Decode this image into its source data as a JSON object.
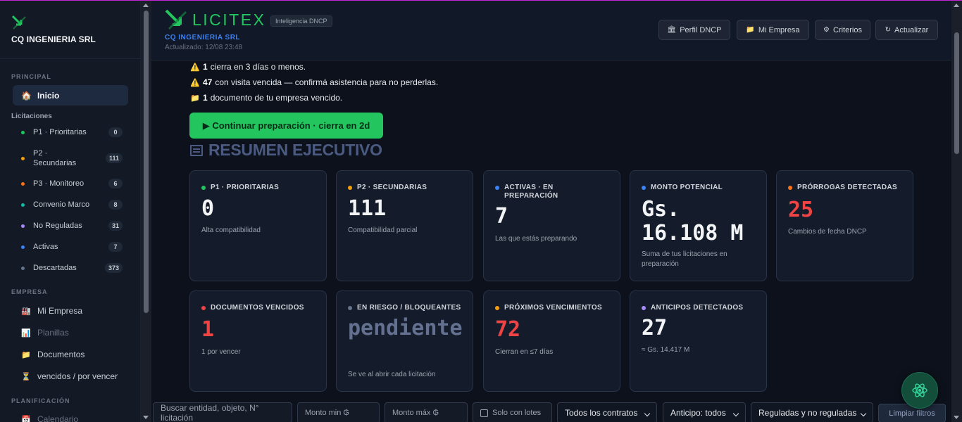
{
  "sidebar": {
    "company": "CQ INGENIERIA SRL",
    "section_principal": "PRINCIPAL",
    "home": {
      "icon": "house-icon",
      "label": "Inicio"
    },
    "section_licitaciones": "Licitaciones",
    "items": [
      {
        "label": "P1 · Prioritarias",
        "count": "0",
        "color": "#22c55e"
      },
      {
        "label": "P2 · Secundarias",
        "count": "111",
        "color": "#f59e0b"
      },
      {
        "label": "P3 · Monitoreo",
        "count": "6",
        "color": "#f97316"
      },
      {
        "label": "Convenio Marco",
        "count": "8",
        "color": "#14b8a6"
      },
      {
        "label": "No Reguladas",
        "count": "31",
        "color": "#a78bfa"
      },
      {
        "label": "Activas",
        "count": "7",
        "color": "#3b82f6"
      },
      {
        "label": "Descartadas",
        "count": "373",
        "color": "#64748b"
      }
    ],
    "section_empresa": "EMPRESA",
    "empresa_links": [
      {
        "label": "Mi Empresa",
        "icon": "factory-icon",
        "muted": false
      },
      {
        "label": "Planillas",
        "icon": "chart-icon",
        "muted": true
      },
      {
        "label": "Documentos",
        "icon": "folder-icon",
        "muted": false
      },
      {
        "label": "vencidos / por vencer",
        "icon": "hourglass-icon",
        "muted": false
      }
    ],
    "section_planificacion": "PLANIFICACIÓN",
    "planificacion_links": [
      {
        "label": "Calendario",
        "icon": "calendar-icon",
        "muted": true
      }
    ]
  },
  "header": {
    "brand": "LICITEX",
    "tag": "Inteligencia DNCP",
    "company": "CQ INGENIERIA SRL",
    "updated": "Actualizado: 12/08 23:48",
    "buttons": [
      {
        "label": "Perfil DNCP",
        "icon": "bank-icon"
      },
      {
        "label": "Mi Empresa",
        "icon": "folder-icon"
      },
      {
        "label": "Criterios",
        "icon": "gear-icon"
      },
      {
        "label": "Actualizar",
        "icon": "refresh-icon"
      }
    ]
  },
  "alerts": [
    {
      "icon": "warning-icon",
      "count": "1",
      "text": "cierra en 3 días o menos."
    },
    {
      "icon": "warning-icon",
      "count": "47",
      "text": "con visita vencida — confirmá asistencia para no perderlas."
    },
    {
      "icon": "folder-icon",
      "count": "1",
      "text": "documento de tu empresa vencido."
    }
  ],
  "cta": {
    "label": "▶ Continuar preparación · cierra en 2d"
  },
  "resumen": {
    "title": "RESUMEN EJECUTIVO"
  },
  "cards": [
    {
      "title": "P1 · PRIORITARIAS",
      "value": "0",
      "sub": "Alta compatibilidad",
      "dot": "#22c55e",
      "value_color": "#f3f4f6"
    },
    {
      "title": "P2 · SECUNDARIAS",
      "value": "111",
      "sub": "Compatibilidad parcial",
      "dot": "#f59e0b",
      "value_color": "#f3f4f6"
    },
    {
      "title": "ACTIVAS · EN PREPARACIÓN",
      "value": "7",
      "sub": "Las que estás preparando",
      "dot": "#3b82f6",
      "value_color": "#f3f4f6"
    },
    {
      "title": "MONTO POTENCIAL",
      "value": "Gs. 16.108 M",
      "sub": "Suma de tus licitaciones en preparación",
      "dot": "#3b82f6",
      "value_color": "#f3f4f6"
    },
    {
      "title": "PRÓRROGAS DETECTADAS",
      "value": "25",
      "sub": "Cambios de fecha DNCP",
      "dot": "#f97316",
      "value_color": "#ef4444"
    },
    {
      "title": "DOCUMENTOS VENCIDOS",
      "value": "1",
      "sub": "1 por vencer",
      "dot": "#ef4444",
      "value_color": "#ef4444"
    },
    {
      "title": "EN RIESGO / BLOQUEANTES",
      "value": "pendiente",
      "sub": "Se ve al abrir cada licitación",
      "dot": "#64748b",
      "value_color": "#64708f"
    },
    {
      "title": "PRÓXIMOS VENCIMIENTOS",
      "value": "72",
      "sub": "Cierran en ≤7 días",
      "dot": "#f59e0b",
      "value_color": "#ef4444"
    },
    {
      "title": "ANTICIPOS DETECTADOS",
      "value": "27",
      "sub": "≈ Gs. 14.417 M",
      "dot": "#a78bfa",
      "value_color": "#f3f4f6"
    }
  ],
  "filters": {
    "search_placeholder": "Buscar entidad, objeto, N° licitación",
    "monto_min_placeholder": "Monto min ₲",
    "monto_max_placeholder": "Monto máx ₲",
    "solo_lotes": "Solo con lotes",
    "contratos": "Todos los contratos",
    "anticipo": "Anticipo: todos",
    "reguladas": "Reguladas y no reguladas",
    "clear": "Limpiar filtros"
  },
  "colors": {
    "accent": "#22c55e",
    "danger": "#ef4444",
    "link": "#3b82f6"
  }
}
